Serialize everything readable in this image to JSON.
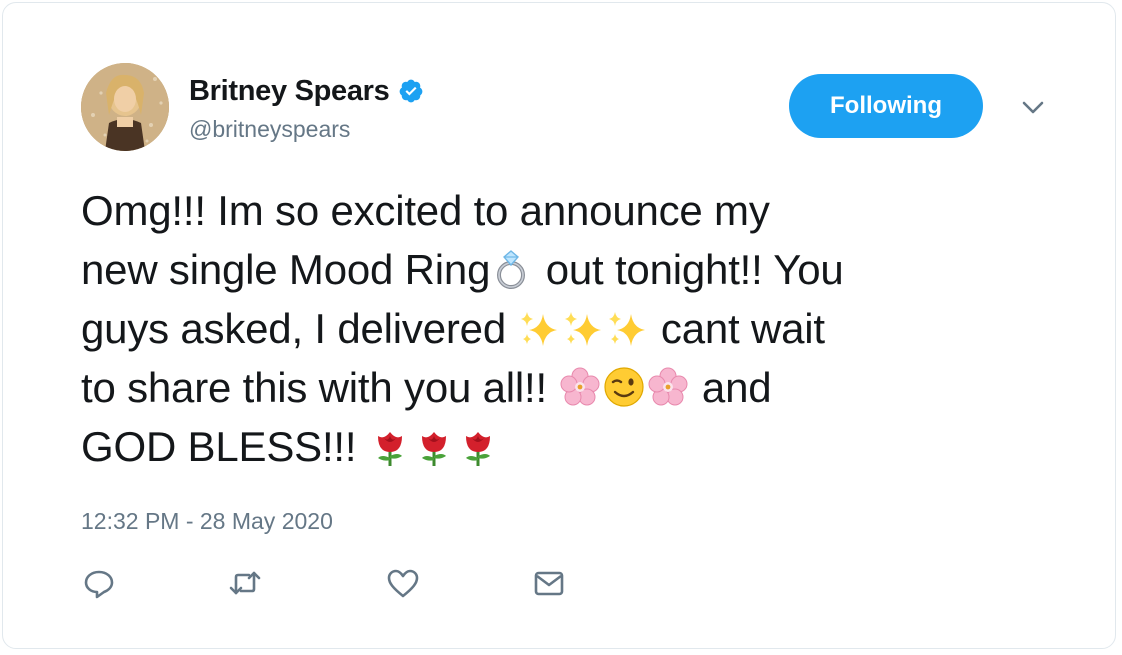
{
  "user": {
    "display_name": "Britney Spears",
    "handle": "@britneyspears",
    "verified_icon": "verified-badge-icon"
  },
  "follow_button": {
    "label": "Following"
  },
  "tweet": {
    "lines": [
      {
        "parts": [
          "Omg!!! Im so excited to announce my"
        ]
      },
      {
        "parts": [
          "new single Mood Ring",
          " out tonight!! You"
        ]
      },
      {
        "parts": [
          "guys asked, I delivered ",
          " cant wait"
        ]
      },
      {
        "parts": [
          "to share this with you all!! ",
          " and"
        ]
      },
      {
        "parts": [
          "GOD BLESS!!! "
        ]
      }
    ],
    "emojis": [
      "ring",
      "sparkles",
      "cherry-blossom",
      "winking-face",
      "rose"
    ]
  },
  "timestamp": "12:32 PM - 28 May 2020",
  "actions": [
    "reply-icon",
    "retweet-icon",
    "like-icon",
    "direct-message-icon"
  ],
  "colors": {
    "accent": "#1da1f2",
    "text": "#14171a",
    "muted": "#657786"
  }
}
